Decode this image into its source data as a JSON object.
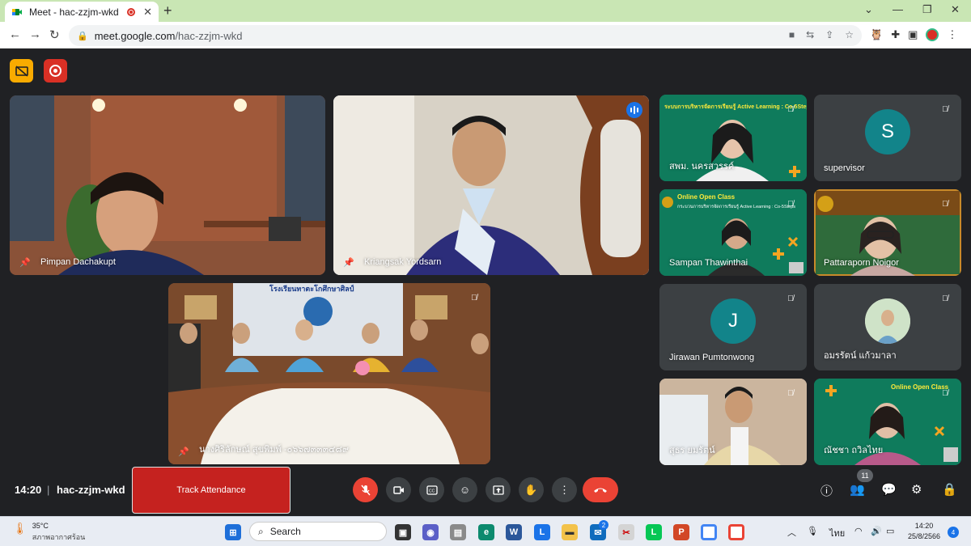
{
  "browser": {
    "tab_title": "Meet - hac-zzjm-wkd",
    "url_host": "meet.google.com",
    "url_path": "/hac-zzjm-wkd",
    "colors": {
      "tabbar_bg": "#c9e6b4",
      "active_speaker": "#8ab4f8"
    }
  },
  "meet": {
    "tiles": [
      {
        "name": "Pimpan Dachakupt",
        "pinned": true
      },
      {
        "name": "Kriangsak Yordsarn",
        "pinned": true,
        "speaking": true
      },
      {
        "name": "สพม. นครสวรรค์",
        "banner": "ระบบการบริหารจัดการเรียนรู้ Active Learning : Co-5Steps"
      },
      {
        "name": "supervisor",
        "initial": "S",
        "avatar_color": "#12848a"
      },
      {
        "name": "Sampan Thawinthai",
        "banner": "Online Open Class",
        "banner2": "กระบวนการบริหารจัดการเรียนรู้ Active Learning : Co-5Steps"
      },
      {
        "name": "Pattaraporn Noigor"
      },
      {
        "name": "นางศิริลักษณ์ สุขพิมพ์ -๐๖๖๗๓๓๓๔๘๙",
        "pinned": true,
        "sign": "โรงเรียนทาตะโกศึกษาศิลป์"
      },
      {
        "name": "Jirawan Pumtonwong",
        "initial": "J",
        "avatar_color": "#12848a"
      },
      {
        "name": "อมรรัตน์ แก้วมาลา"
      },
      {
        "name": "สุธร ยมรัตน์"
      },
      {
        "name": "ณัชชา ถวิลไทย",
        "banner": "Online Open Class"
      }
    ]
  },
  "controls": {
    "time": "14:20",
    "meeting_code": "hac-zzjm-wkd",
    "track_label": "Track Attendance",
    "participant_count": "11"
  },
  "taskbar": {
    "temperature": "35°C",
    "weather_text": "สภาพอากาศร้อน",
    "search_label": "Search",
    "mail_badge": "2",
    "language": "ไทย",
    "time": "14:20",
    "date": "25/8/2566",
    "notification_count": "4"
  }
}
